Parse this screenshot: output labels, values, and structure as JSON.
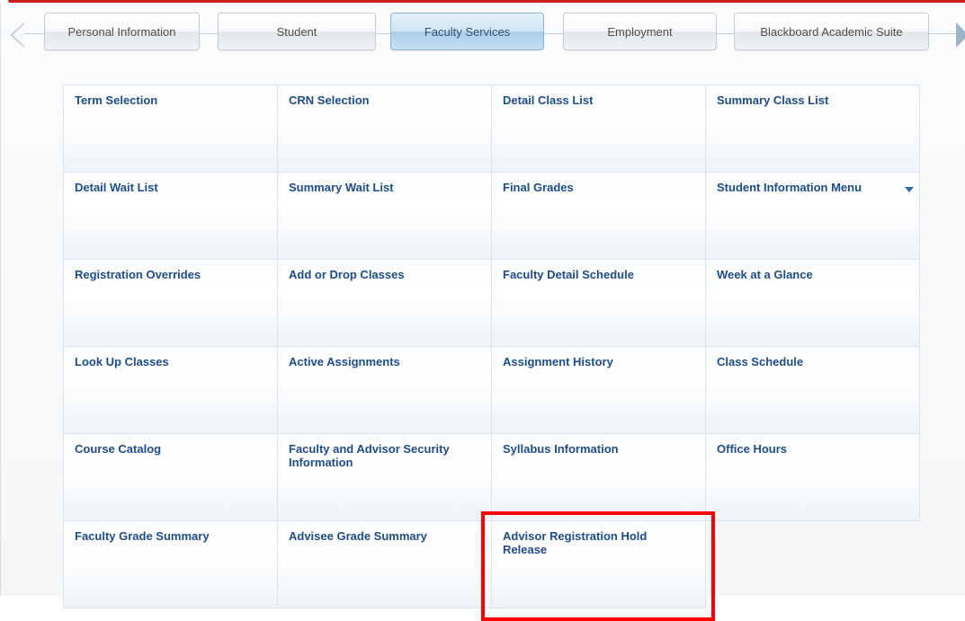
{
  "colors": {
    "accent": "#1f4c87",
    "highlight": "#ff0000",
    "active_tab": "#cfe5f6",
    "top_bar": "#c8221a"
  },
  "icons": {
    "left": "chevron-left-icon",
    "right": "chevron-right-icon",
    "dropdown": "triangle-down-icon"
  },
  "tabs": [
    {
      "label": "Personal Information"
    },
    {
      "label": "Student"
    },
    {
      "label": "Faculty Services",
      "active": true
    },
    {
      "label": "Employment"
    },
    {
      "label": "Blackboard Academic Suite"
    }
  ],
  "menu": {
    "rows": [
      [
        {
          "label": "Term Selection"
        },
        {
          "label": "CRN Selection"
        },
        {
          "label": "Detail Class List"
        },
        {
          "label": "Summary Class List"
        }
      ],
      [
        {
          "label": "Detail Wait List"
        },
        {
          "label": "Summary Wait List"
        },
        {
          "label": "Final Grades"
        },
        {
          "label": "Student Information Menu",
          "dropdown": true
        }
      ],
      [
        {
          "label": "Registration Overrides"
        },
        {
          "label": "Add or Drop Classes"
        },
        {
          "label": "Faculty Detail Schedule"
        },
        {
          "label": "Week at a Glance"
        }
      ],
      [
        {
          "label": "Look Up Classes"
        },
        {
          "label": "Active Assignments"
        },
        {
          "label": "Assignment History"
        },
        {
          "label": "Class Schedule"
        }
      ],
      [
        {
          "label": "Course Catalog"
        },
        {
          "label": "Faculty and Advisor Security Information"
        },
        {
          "label": "Syllabus Information"
        },
        {
          "label": "Office Hours"
        }
      ],
      [
        {
          "label": "Faculty Grade Summary"
        },
        {
          "label": "Advisee Grade Summary"
        },
        {
          "label": "Advisor Registration Hold Release",
          "highlighted": true
        }
      ]
    ]
  }
}
